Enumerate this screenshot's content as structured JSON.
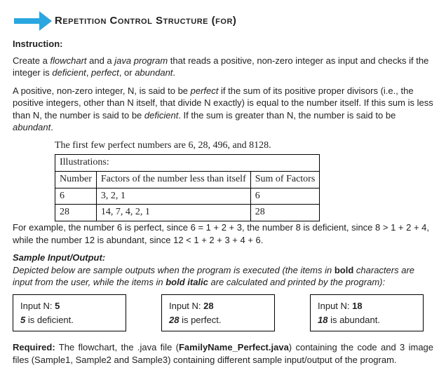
{
  "header": {
    "title": "Repetition Control Structure (for)"
  },
  "instruction": {
    "label": "Instruction:",
    "p1_a": "Create a ",
    "p1_flowchart": "flowchart",
    "p1_b": " and a ",
    "p1_java": "java program",
    "p1_c": " that reads a positive, non-zero integer as input and checks if the integer is ",
    "p1_deficient": "deficient",
    "p1_d": ", ",
    "p1_perfect": "perfect",
    "p1_e": ", or ",
    "p1_abundant": "abundant",
    "p1_f": "."
  },
  "definition": {
    "a": "A positive, non-zero integer, N, is said to be ",
    "perfect": "perfect",
    "b": " if the sum of its positive proper divisors (i.e., the positive integers, other than N itself, that divide N exactly) is equal to the number itself. If this sum is less than N, the number is said to be ",
    "deficient": "deficient",
    "c": ". If the sum is greater than N, the number is said to be ",
    "abundant": "abundant",
    "d": "."
  },
  "perfect_line": "The first few perfect numbers are 6, 28, 496, and 8128.",
  "illus_label": "Illustrations:",
  "table": {
    "h1": "Number",
    "h2": "Factors of the number less than itself",
    "h3": "Sum of Factors",
    "rows": [
      {
        "n": "6",
        "f": "3, 2, 1",
        "s": "6"
      },
      {
        "n": "28",
        "f": "14, 7, 4, 2, 1",
        "s": "28"
      }
    ]
  },
  "example": "For example, the number 6 is perfect, since 6 = 1 + 2 + 3, the number 8 is deficient, since 8 > 1 + 2 + 4, while the number 12 is abundant, since 12 < 1 + 2 + 3 + 4 + 6.",
  "sample": {
    "heading": "Sample Input/Output:",
    "desc_a": "Depicted below are sample outputs when the program is executed (the items in ",
    "desc_bold": "bold",
    "desc_b": " characters are input from the user, while the items in ",
    "desc_bi": "bold italic",
    "desc_c": " are calculated and printed by the program):",
    "boxes": [
      {
        "prompt": "Input N: ",
        "val": "5",
        "res_n": "5",
        "res_txt": " is deficient."
      },
      {
        "prompt": "Input N: ",
        "val": "28",
        "res_n": "28",
        "res_txt": " is perfect."
      },
      {
        "prompt": "Input N: ",
        "val": "18",
        "res_n": "18",
        "res_txt": " is abundant."
      }
    ]
  },
  "required": {
    "label": "Required:",
    "a": " The flowchart, the .java file (",
    "file": "FamilyName_Perfect.java",
    "b": ") containing the code and 3 image files (Sample1, Sample2 and Sample3) containing different sample input/output of the program."
  }
}
